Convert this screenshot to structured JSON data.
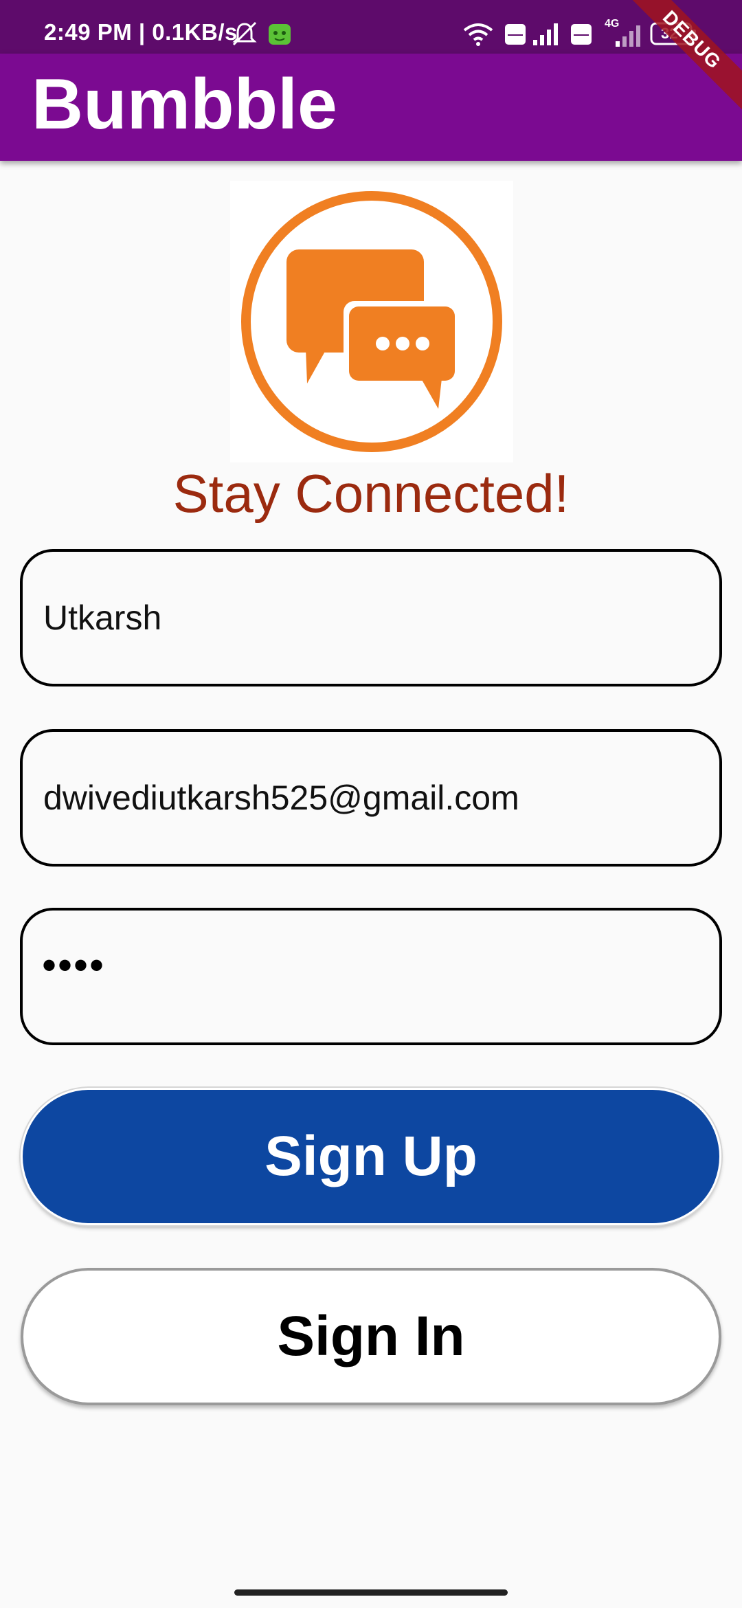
{
  "status_bar": {
    "time": "2:49 PM | 0.1KB/s",
    "battery": "32",
    "network_label": "4G",
    "icons": [
      "mute-icon",
      "app-notification-icon",
      "wifi-icon",
      "volte-icon",
      "signal-icon",
      "volte-icon",
      "signal-icon",
      "battery-icon"
    ]
  },
  "app_bar": {
    "title": "Bumbble",
    "debug_label": "DEBUG",
    "colors": {
      "background": "#7b0a91",
      "status_bar": "#5e0b6b"
    }
  },
  "logo": {
    "icon": "chat-bubbles-icon",
    "color": "#f07f22"
  },
  "tagline": "Stay Connected!",
  "form": {
    "name_value": "Utkarsh",
    "email_value": "dwivediutkarsh525@gmail.com",
    "password_mask": "••••"
  },
  "buttons": {
    "sign_up": "Sign Up",
    "sign_in": "Sign In",
    "sign_up_color": "#0d47a1"
  }
}
